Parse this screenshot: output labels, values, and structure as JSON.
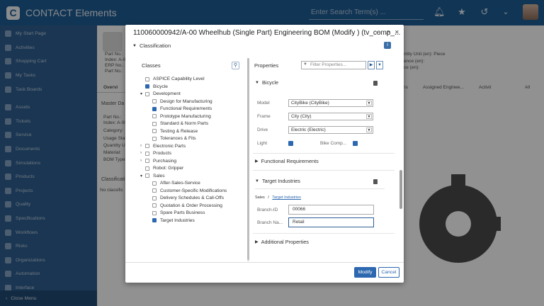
{
  "app": {
    "title": "CONTACT Elements",
    "logo_letter": "C",
    "search_placeholder": "Enter Search Term(s) ..."
  },
  "sidebar": {
    "items": [
      {
        "label": "My Start Page"
      },
      {
        "label": "Activities"
      },
      {
        "label": "Shopping Cart"
      },
      {
        "label": "My Tasks"
      },
      {
        "label": "Task Boards"
      },
      {
        "label": "Assets"
      },
      {
        "label": "Tickets"
      },
      {
        "label": "Service"
      },
      {
        "label": "Documents"
      },
      {
        "label": "Simulations"
      },
      {
        "label": "Products"
      },
      {
        "label": "Projects"
      },
      {
        "label": "Quality"
      },
      {
        "label": "Specifications"
      },
      {
        "label": "Workflows"
      },
      {
        "label": "Risks"
      },
      {
        "label": "Organizations"
      },
      {
        "label": "Automation"
      },
      {
        "label": "Interface"
      }
    ],
    "close_menu": "Close Menu"
  },
  "background": {
    "part_no": "Part No.:",
    "index": "Index: A-00",
    "erp_no": "ERP No.:",
    "part_no2": "Part No.:",
    "overview_tab": "Overvi",
    "master_data": "Master Da",
    "md_part": "Part No.:",
    "md_index": "Index: A-00",
    "md_category": "Category:",
    "md_usage": "Usage Stat",
    "md_quantity": "Quantity U",
    "md_material": "Material:",
    "md_bom": "BOM Type:",
    "classif": "Classificati",
    "no_classif": "No classific",
    "unit": "ntity Unit (en): Piece",
    "sunit": "ence (en):",
    "unit2": "ce (en):",
    "mat": "aterial:",
    "tab_ns": "ns",
    "tab_assigned": "Assigned Enginee...",
    "tab_activit": "Activit",
    "tab_all": "All"
  },
  "dialog": {
    "title": "110060000942/A-00 Wheelhub (Single Part) Engineering BOM (Modify ) (tv_comp_...",
    "section": "Classification",
    "classes_title": "Classes",
    "properties_title": "Properties",
    "filter_placeholder": "Filter Properties...",
    "tree": [
      {
        "label": "ASPICE Capability Level",
        "checked": false
      },
      {
        "label": "Bicycle",
        "checked": true
      },
      {
        "label": "Development",
        "checked": false
      },
      {
        "label": "Design for Manufacturing",
        "checked": false
      },
      {
        "label": "Functional Requirements",
        "checked": true
      },
      {
        "label": "Prototype Manufacturing",
        "checked": false
      },
      {
        "label": "Standard & Norm Parts",
        "checked": false
      },
      {
        "label": "Testing & Release",
        "checked": false
      },
      {
        "label": "Tolerances & Fits",
        "checked": false
      },
      {
        "label": "Electronic Parts",
        "checked": false
      },
      {
        "label": "Products",
        "checked": false
      },
      {
        "label": "Purchasing",
        "checked": false
      },
      {
        "label": "Robot: Gripper",
        "checked": false
      },
      {
        "label": "Sales",
        "checked": false
      },
      {
        "label": "After-Sales-Service",
        "checked": false
      },
      {
        "label": "Customer-Specific Modifications",
        "checked": false
      },
      {
        "label": "Delivery Schedules & Call-Offs",
        "checked": false
      },
      {
        "label": "Quotation & Order Processing",
        "checked": false
      },
      {
        "label": "Spare Parts Business",
        "checked": false
      },
      {
        "label": "Target Industries",
        "checked": true
      }
    ],
    "bicycle": {
      "title": "Bicycle",
      "model_label": "Model",
      "model_value": "CityBike (CityBike)",
      "frame_label": "Frame",
      "frame_value": "City (City)",
      "drive_label": "Drive",
      "drive_value": "Electric (Electric)",
      "light_label": "Light",
      "light_checked": true,
      "bikecomp_label": "Bike Comp...",
      "bikecomp_checked": true
    },
    "functional_requirements": "Functional Requirements",
    "target_industries": {
      "title": "Target Industries",
      "breadcrumb_root": "Sales",
      "breadcrumb_sep": "/",
      "breadcrumb_leaf": "Target Industries",
      "branch_id_label": "Branch-ID",
      "branch_id_value": "00066",
      "branch_name_label": "Branch Na...",
      "branch_name_value": "Retail"
    },
    "additional_properties": "Additional Properties",
    "modify": "Modify",
    "cancel": "Cancel"
  },
  "colors": {
    "topbar": "#1f5d96",
    "sidebar": "#2f5f90",
    "primary": "#2c67b0"
  }
}
